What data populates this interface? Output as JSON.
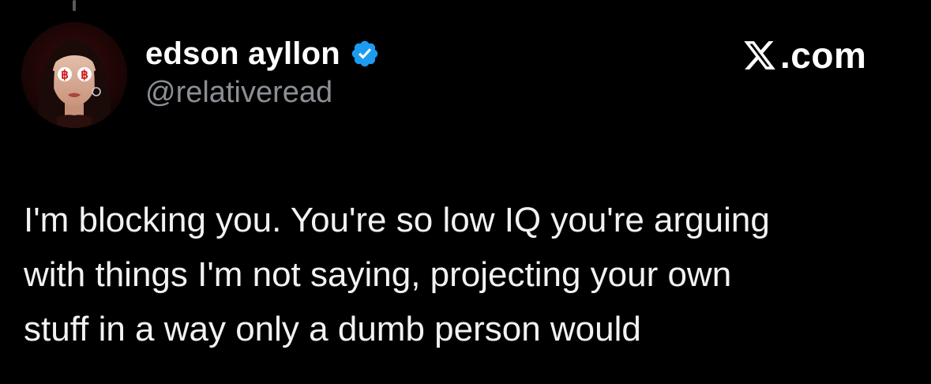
{
  "author": {
    "display_name": "edson ayllon",
    "handle": "@relativeread",
    "verified": true,
    "avatar_icon": "avatar-bitcoin-eyes",
    "verified_color": "#1d9bf0"
  },
  "watermark": {
    "logo_icon": "x-logo-icon",
    "text": ".com"
  },
  "tweet": {
    "lines": [
      "I'm blocking you. You're so low IQ you're arguing",
      "with things I'm not saying, projecting your own",
      "stuff in a way only a dumb person would"
    ]
  },
  "colors": {
    "background": "#000000",
    "primary_text": "#ffffff",
    "secondary_text": "#8b8f94"
  }
}
